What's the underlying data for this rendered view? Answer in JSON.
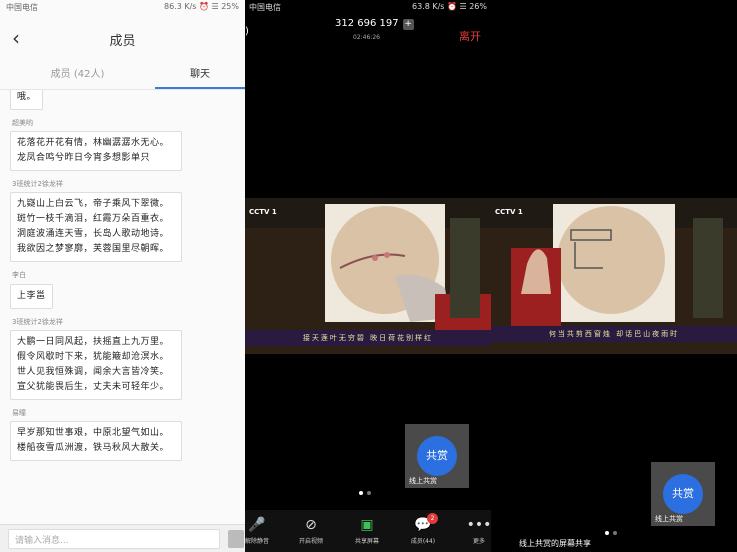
{
  "panel1": {
    "status": {
      "left": "中国电信",
      "right": "86.3 K/s ⏰ ☰ 25%"
    },
    "nav": {
      "title": "成员"
    },
    "tabs": [
      {
        "label": "成员 (42人)"
      },
      {
        "label": "聊天"
      }
    ],
    "messages": [
      {
        "sender": "",
        "text": "哦。"
      },
      {
        "sender": "超美哟",
        "text": "花落花开花有情，林幽潺潺水无心。龙凤合鸣兮昨日今宵多想影单只"
      },
      {
        "sender": "3班统计2徐龙祥",
        "text": "九嶷山上白云飞，帝子乘风下翠微。斑竹一枝千滴泪，红霞万朵百重衣。洞庭波涌连天雪，长岛人歌动地诗。我欲因之梦寥廓，芙蓉国里尽朝晖。"
      },
      {
        "sender": "李白",
        "text": "上李邕"
      },
      {
        "sender": "3班统计2徐龙祥",
        "text": "大鹏一日同风起，扶摇直上九万里。假令风歇时下来，犹能簸却沧溟水。世人见我恒殊调，闻余大言皆冷笑。宣父犹能畏后生，丈夫未可轻年少。"
      },
      {
        "sender": "易瞳",
        "text": "早岁那知世事艰，中原北望气如山。楼船夜雪瓜洲渡，铁马秋风大散关。"
      }
    ],
    "input": {
      "placeholder": "请输入消息..."
    }
  },
  "panel2": {
    "status": {
      "left": "中国电信",
      "right": "63.8 K/s ⏰ ☰ 26%"
    },
    "meeting_id": "312 696 197",
    "timer": "02:46:26",
    "leave_label": "离开",
    "video": {
      "logo": "CCTV 1",
      "caption": "接天莲叶无穷碧 映日荷花别样红"
    },
    "share_button": "共赏",
    "share_label": "线上共赏",
    "toolbar": [
      {
        "icon": "mic-icon",
        "label": "解除静音"
      },
      {
        "icon": "camera-off-icon",
        "label": "开启视频"
      },
      {
        "icon": "screen-share-icon",
        "label": "共享屏幕"
      },
      {
        "icon": "members-icon",
        "label": "成员(44)",
        "badge": "2"
      },
      {
        "icon": "more-icon",
        "label": "更多"
      }
    ]
  },
  "panel3": {
    "video": {
      "logo": "CCTV 1",
      "caption": "何当共剪西窗烛 却话巴山夜雨时"
    },
    "share_button": "共赏",
    "share_label": "线上共赏",
    "bottom_text": "线上共赏的屏幕共享"
  },
  "colors": {
    "accent_blue": "#2c6fe0",
    "leave_red": "#e23b3b",
    "tab_underline": "#3a7ad8"
  }
}
